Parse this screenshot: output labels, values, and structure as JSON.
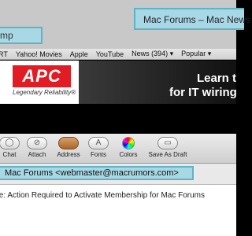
{
  "browser": {
    "left_tab_text": "mp",
    "right_tab_text": "Mac Forums – Mac News"
  },
  "bookmarks": [
    "RT",
    "Yahoo! Movies",
    "Apple",
    "YouTube",
    "News (394) ▾",
    "Popular ▾"
  ],
  "ad": {
    "logo": "APC",
    "tagline": "Legendary Reliability®",
    "line1": "Learn t",
    "line2": "for IT wiring"
  },
  "mail_toolbar": [
    {
      "name": "chat",
      "label": "Chat",
      "icon": "chat-icon"
    },
    {
      "name": "attach",
      "label": "Attach",
      "icon": "paperclip-icon"
    },
    {
      "name": "address",
      "label": "Address",
      "icon": "address-book-icon"
    },
    {
      "name": "fonts",
      "label": "Fonts",
      "icon": "fonts-icon"
    },
    {
      "name": "colors",
      "label": "Colors",
      "icon": "color-wheel-icon"
    },
    {
      "name": "save-as-draft",
      "label": "Save As Draft",
      "icon": "draft-icon"
    }
  ],
  "mail": {
    "from": "Mac Forums <webmaster@macrumors.com>",
    "subject": "te: Action Required to Activate Membership for Mac Forums"
  }
}
